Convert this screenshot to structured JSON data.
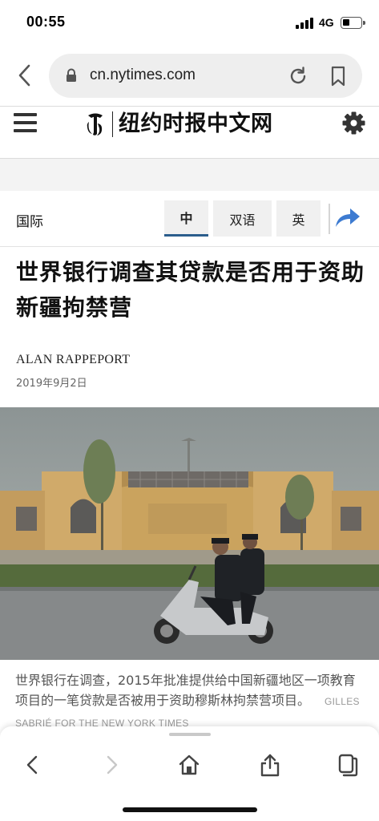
{
  "status_bar": {
    "time": "00:55",
    "network": "4G"
  },
  "browser": {
    "url": "cn.nytimes.com"
  },
  "masthead": {
    "logo_text": "纽约时报中文网"
  },
  "section": {
    "label": "国际",
    "language_tabs": [
      {
        "label": "中",
        "active": true
      },
      {
        "label": "双语",
        "active": false
      },
      {
        "label": "英",
        "active": false
      }
    ]
  },
  "article": {
    "headline": "世界银行调查其贷款是否用于资助新疆拘禁营",
    "author": "ALAN RAPPEPORT",
    "date": "2019年9月2日",
    "caption": "世界银行在调查，2015年批准提供给中国新疆地区一项教育项目的一笔贷款是否被用于资助穆斯林拘禁营项目。",
    "photo_credit": "GILLES SABRIÉ FOR THE NEW YORK TIMES"
  },
  "toolbar": {
    "items": [
      "back-icon",
      "forward-icon",
      "home-icon",
      "share-icon",
      "tabs-icon"
    ]
  },
  "colors": {
    "accent_blue": "#2b5d8c",
    "share_blue": "#3d7bd1"
  }
}
